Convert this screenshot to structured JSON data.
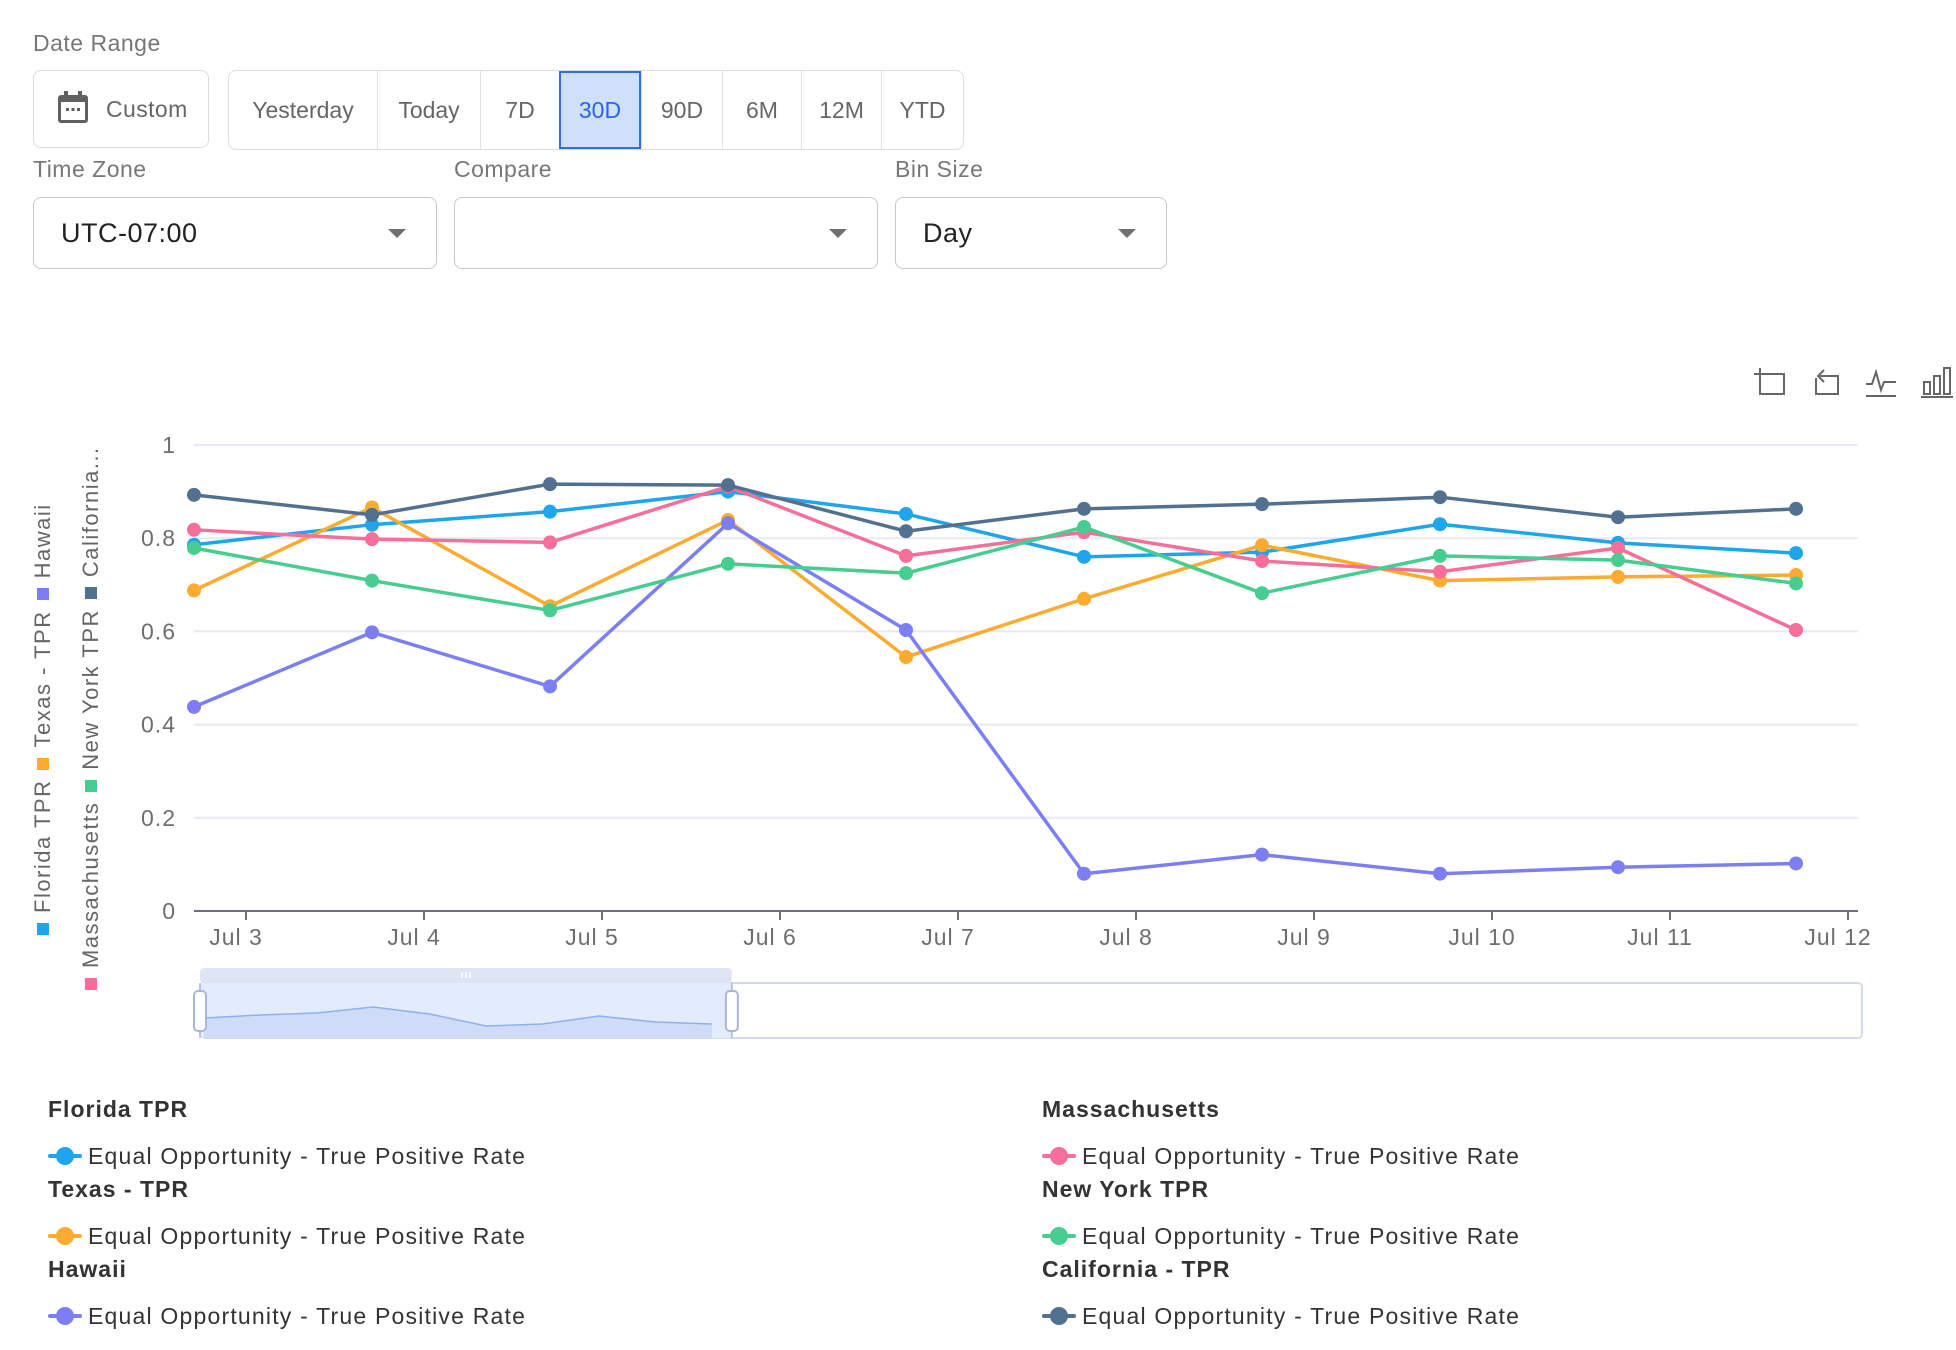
{
  "filters": {
    "date_range_label": "Date Range",
    "custom_label": "Custom",
    "ranges": [
      "Yesterday",
      "Today",
      "7D",
      "30D",
      "90D",
      "6M",
      "12M",
      "YTD"
    ],
    "active_range": "30D",
    "time_zone": {
      "label": "Time Zone",
      "value": "UTC-07:00"
    },
    "compare": {
      "label": "Compare",
      "value": ""
    },
    "bin_size": {
      "label": "Bin Size",
      "value": "Day"
    }
  },
  "toolbox": [
    "data-zoom-icon",
    "restore-icon",
    "line-chart-icon",
    "bar-chart-icon"
  ],
  "legend_vertical": [
    [
      "Florida TPR",
      "Texas - TPR",
      "Hawaii"
    ],
    [
      "Massachusetts",
      "New York TPR",
      "California..."
    ]
  ],
  "chart_data": {
    "type": "line",
    "title": "",
    "xlabel": "",
    "ylabel": "",
    "x": [
      "Jul 3",
      "Jul 4",
      "Jul 5",
      "Jul 6",
      "Jul 7",
      "Jul 8",
      "Jul 9",
      "Jul 10",
      "Jul 11",
      "Jul 12"
    ],
    "x_ticks": [
      "Jul 3",
      "Jul 4",
      "Jul 5",
      "Jul 6",
      "Jul 7",
      "Jul 8",
      "Jul 9",
      "Jul 10",
      "Jul 11",
      "Jul 12"
    ],
    "y_ticks": [
      "0",
      "0.2",
      "0.4",
      "0.6",
      "0.8",
      "1"
    ],
    "ylim": [
      0,
      1
    ],
    "grid": true,
    "legend_position": "left-vertical and bottom",
    "data_zoom": {
      "start_fraction": 0.0,
      "end_fraction": 0.32
    },
    "series": [
      {
        "name": "Florida TPR",
        "metric": "Equal Opportunity - True Positive Rate",
        "color": "#1ea5ec",
        "values": [
          0.786,
          0.829,
          0.857,
          0.9,
          0.852,
          0.76,
          0.77,
          0.83,
          0.79,
          0.768
        ]
      },
      {
        "name": "Texas - TPR",
        "metric": "Equal Opportunity - True Positive Rate",
        "color": "#fbab30",
        "values": [
          0.688,
          0.866,
          0.654,
          0.839,
          0.545,
          0.67,
          0.785,
          0.709,
          0.717,
          0.721
        ]
      },
      {
        "name": "Hawaii",
        "metric": "Equal Opportunity - True Positive Rate",
        "color": "#7c7ff3",
        "values": [
          0.438,
          0.598,
          0.482,
          0.832,
          0.603,
          0.08,
          0.121,
          0.08,
          0.094,
          0.102
        ]
      },
      {
        "name": "Massachusetts",
        "metric": "Equal Opportunity - True Positive Rate",
        "color": "#f56f98",
        "values": [
          0.818,
          0.798,
          0.791,
          0.911,
          0.762,
          0.813,
          0.751,
          0.728,
          0.779,
          0.603
        ]
      },
      {
        "name": "New York TPR",
        "metric": "Equal Opportunity - True Positive Rate",
        "color": "#46cd8f",
        "values": [
          0.779,
          0.709,
          0.645,
          0.745,
          0.725,
          0.824,
          0.682,
          0.762,
          0.753,
          0.703
        ]
      },
      {
        "name": "California - TPR",
        "metric": "Equal Opportunity - True Positive Rate",
        "color": "#52708f",
        "values": [
          0.893,
          0.85,
          0.916,
          0.914,
          0.815,
          0.863,
          0.873,
          0.888,
          0.845,
          0.863
        ]
      }
    ]
  }
}
